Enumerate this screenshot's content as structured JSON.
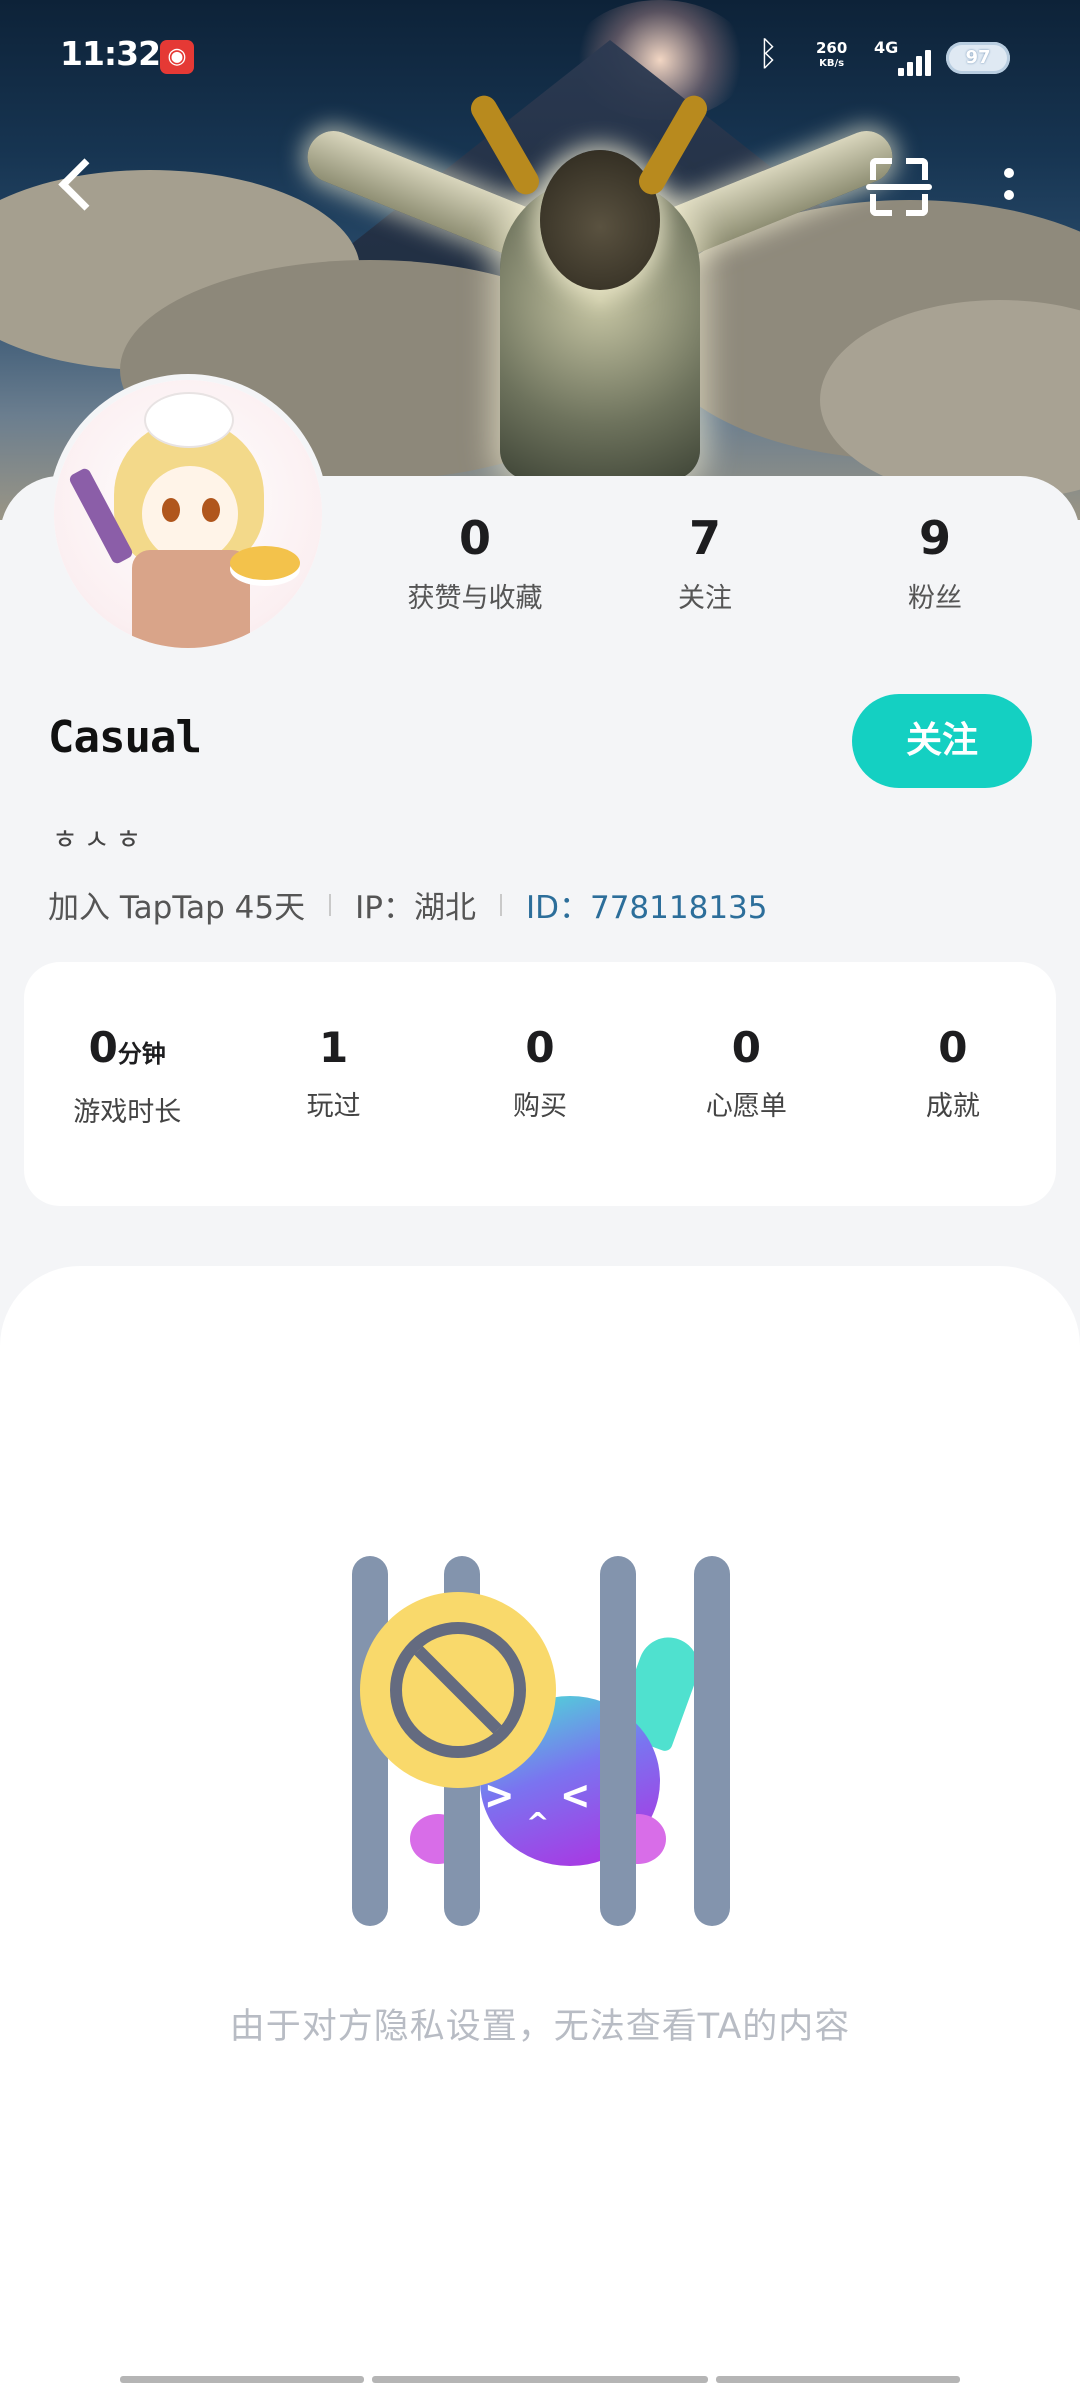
{
  "status_bar": {
    "time": "11:32",
    "app_badge_icon": "netease-music-icon",
    "bluetooth_icon": "bluetooth-icon",
    "net_speed": "260",
    "net_unit": "KB/s",
    "signal_label": "4G",
    "battery": "97"
  },
  "nav": {
    "back_icon": "chevron-left-icon",
    "scan_icon": "scan-icon",
    "more_icon": "more-vertical-icon"
  },
  "profile": {
    "stats": [
      {
        "value": "0",
        "label": "获赞与收藏"
      },
      {
        "value": "7",
        "label": "关注"
      },
      {
        "value": "9",
        "label": "粉丝"
      }
    ],
    "name": "Casual",
    "follow_label": "关注",
    "bio": "ㅎㅅㅎ",
    "joined": "加入 TapTap 45天",
    "ip": "IP：湖北",
    "id": "ID：778118135"
  },
  "game_stats": [
    {
      "value": "0",
      "unit": "分钟",
      "label": "游戏时长"
    },
    {
      "value": "1",
      "unit": "",
      "label": "玩过"
    },
    {
      "value": "0",
      "unit": "",
      "label": "购买"
    },
    {
      "value": "0",
      "unit": "",
      "label": "心愿单"
    },
    {
      "value": "0",
      "unit": "",
      "label": "成就"
    }
  ],
  "private_message": "由于对方隐私设置，无法查看TA的内容",
  "colors": {
    "accent": "#14d0c2",
    "id_link": "#2c6e9a",
    "muted_text": "#b8bcc4"
  }
}
